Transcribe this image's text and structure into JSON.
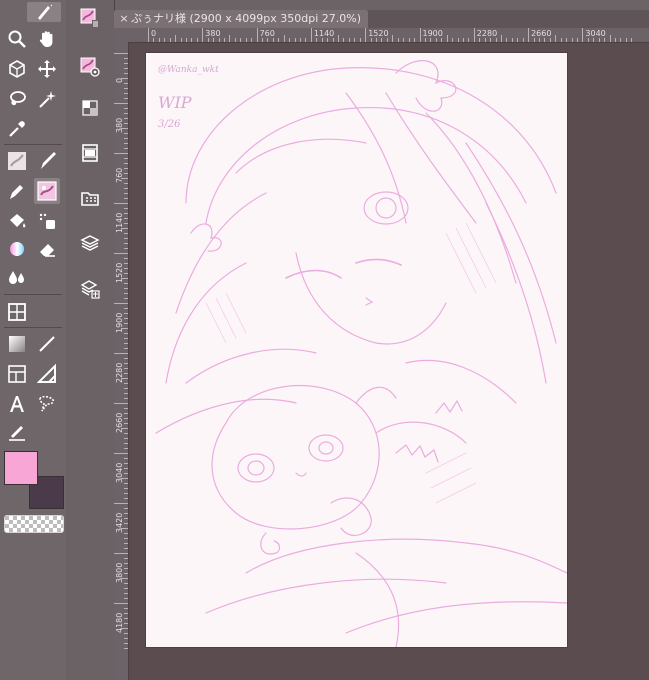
{
  "document": {
    "tab_title": "ぷぅナリ様 (2900 x 4099px 350dpi 27.0%)",
    "close_glyph": "×"
  },
  "rulers": {
    "horizontal": [
      "0",
      "380",
      "760",
      "1140",
      "1520",
      "1900",
      "2280",
      "2660",
      "3040"
    ],
    "vertical": [
      "0",
      "380",
      "760",
      "1140",
      "1520",
      "1900",
      "2280",
      "2660",
      "3040",
      "3420",
      "3800",
      "4180"
    ]
  },
  "canvas": {
    "watermark": "@Wanka_wkt",
    "note_line1": "WIP",
    "note_line2": "3/26"
  },
  "colors": {
    "main_color": "#f7a6d6",
    "sub_color": "#4a3a4a",
    "sketch_line": "#e8a6dc",
    "panel_bg": "#6e6669",
    "tab_bg": "#7b7175"
  },
  "tools": [
    "pen-icon",
    "zoom-icon",
    "hand-icon",
    "object-icon",
    "move-icon",
    "lasso-icon",
    "auto-select-icon",
    "eyedropper-icon",
    "brush-preset-icon",
    "pen-nib-icon",
    "marker-icon",
    "active-brush-icon",
    "fill-icon",
    "tone-icon",
    "gradient-icon",
    "eraser-icon",
    "blend-icon",
    "frame-icon",
    "rectangle-icon",
    "line-icon",
    "panel-icon",
    "ruler-icon",
    "text-icon",
    "balloon-icon",
    "correction-icon"
  ],
  "side_icons": [
    "brush-sub-tool-icon",
    "brush-settings-icon",
    "navigator-icon",
    "animation-icon",
    "material-icon",
    "layers-icon",
    "layer-property-icon"
  ]
}
